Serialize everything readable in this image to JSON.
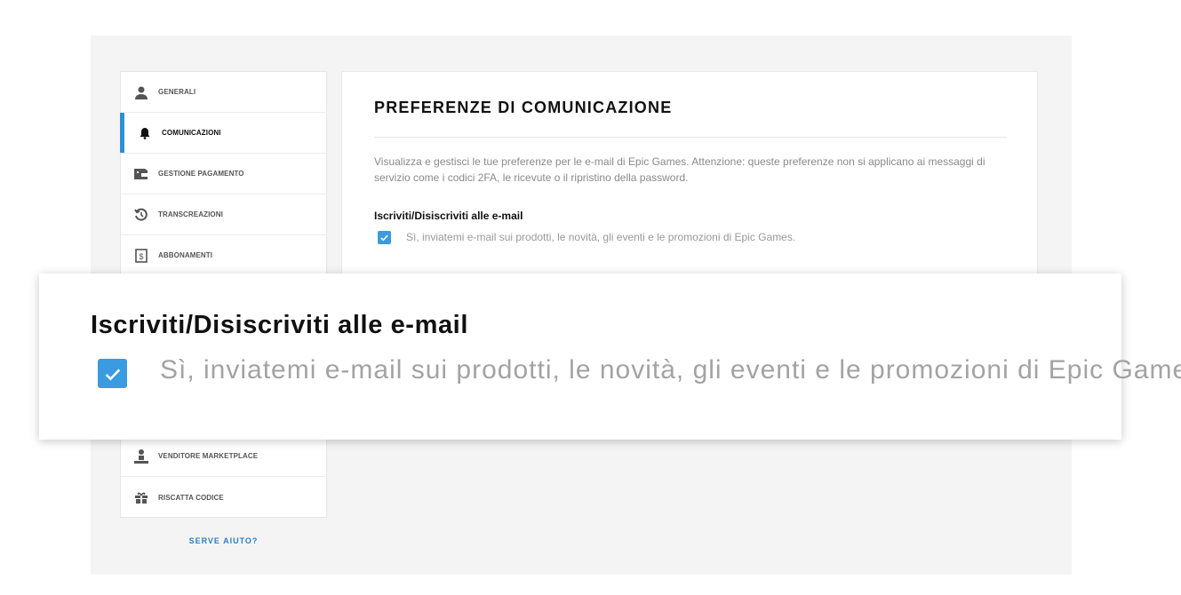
{
  "sidebar": {
    "items": [
      {
        "label": "GENERALI",
        "icon": "user-icon"
      },
      {
        "label": "COMUNICAZIONI",
        "icon": "bell-icon",
        "active": true
      },
      {
        "label": "GESTIONE PAGAMENTO",
        "icon": "wallet-icon"
      },
      {
        "label": "TRANSCREAZIONI",
        "icon": "history-icon"
      },
      {
        "label": "ABBONAMENTI",
        "icon": "subscription-icon"
      },
      {
        "label": "VENDITORE MARKETPLACE",
        "icon": "seller-icon"
      },
      {
        "label": "RISCATTA CODICE",
        "icon": "gift-icon"
      }
    ],
    "help_label": "SERVE AIUTO?"
  },
  "main": {
    "title": "PREFERENZE DI COMUNICAZIONE",
    "description": "Visualizza e gestisci le tue preferenze per le e-mail di Epic Games. Attenzione: queste preferenze non si applicano ai messaggi di servizio come i codici 2FA, le ricevute o il ripristino della password.",
    "subscribe_heading": "Iscriviti/Disiscriviti alle e-mail",
    "checkbox_label": "Sì, inviatemi e-mail sui prodotti, le novità, gli eventi e le promozioni di Epic Games.",
    "checkbox_checked": true
  },
  "zoom": {
    "heading": "Iscriviti/Disiscriviti alle e-mail",
    "checkbox_label": "Sì, inviatemi e-mail sui prodotti, le novità, gli eventi e le promozioni di Epic Games.",
    "checkbox_checked": true
  },
  "colors": {
    "accent": "#2d8fd6",
    "checkbox": "#3a9be0",
    "help_link": "#2d7fc6"
  }
}
